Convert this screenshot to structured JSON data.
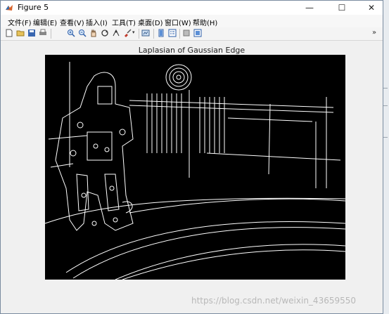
{
  "window": {
    "title": "Figure 5",
    "controls": {
      "minimize": "—",
      "maximize": "☐",
      "close": "✕"
    }
  },
  "menu": {
    "items": [
      "文件(F)",
      "编辑(E)",
      "查看(V)",
      "插入(I)",
      "工具(T)",
      "桌面(D)",
      "窗口(W)",
      "帮助(H)"
    ]
  },
  "toolbar": {
    "icons": [
      "new-figure-icon",
      "open-file-icon",
      "save-icon",
      "print-icon",
      "zoom-in-icon",
      "zoom-out-icon",
      "pan-icon",
      "rotate-3d-icon",
      "data-cursor-icon",
      "brush-icon",
      "link-plot-icon",
      "colorbar-icon",
      "legend-icon",
      "hide-plot-tools-icon",
      "show-plot-tools-icon"
    ],
    "expand": "»"
  },
  "figure": {
    "plot_title": "Laplasian of Gaussian Edge",
    "image_background": "#000000",
    "edge_color": "#ffffff"
  },
  "watermark": "https://blog.csdn.net/weixin_43659550"
}
